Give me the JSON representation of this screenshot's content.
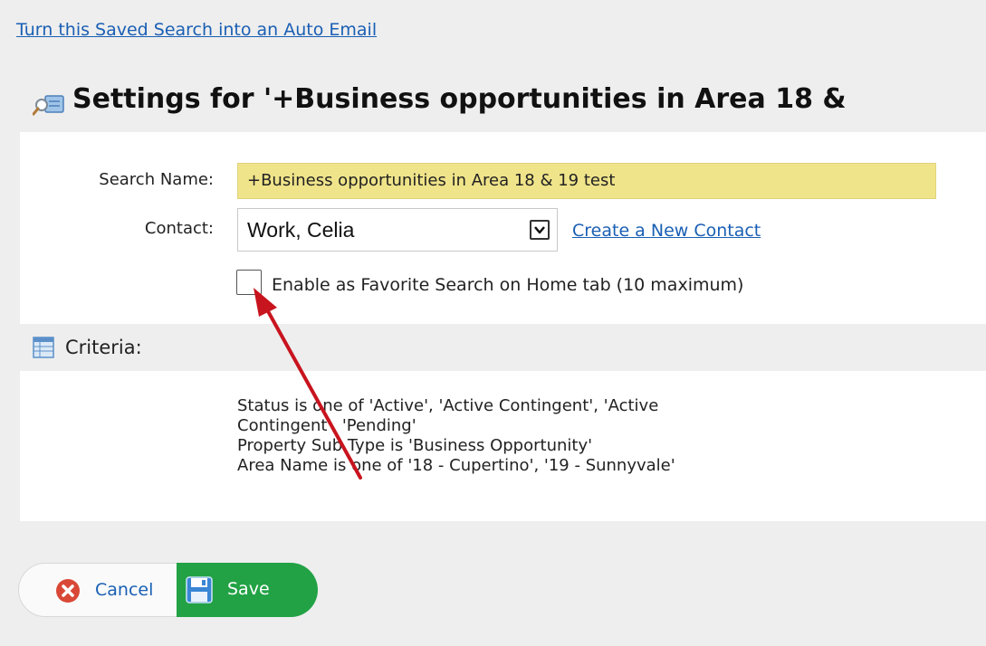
{
  "header": {
    "auto_email_link": "Turn this Saved Search into an Auto Email",
    "title": "Settings for '+Business opportunities in Area 18 &"
  },
  "form": {
    "search_name_label": "Search Name:",
    "search_name_value": "+Business opportunities in Area 18 & 19 test",
    "contact_label": "Contact:",
    "contact_value": "Work, Celia",
    "create_contact_link": "Create a New Contact",
    "favorite_checked": false,
    "favorite_label": "Enable as Favorite Search on Home tab (10 maximum)"
  },
  "criteria": {
    "label": "Criteria:",
    "lines": [
      "Status is one of 'Active', 'Active Contingent', 'Active",
      "Contingent', 'Pending'",
      "Property Sub Type is 'Business Opportunity'",
      "Area Name is one of '18 - Cupertino', '19 - Sunnyvale'"
    ]
  },
  "buttons": {
    "cancel_label": "Cancel",
    "save_label": "Save"
  },
  "icons": {
    "title": "saved-search-icon",
    "criteria": "table-icon",
    "cancel": "cancel-x-icon",
    "save": "floppy-disk-icon",
    "dropdown": "chevron-down-icon",
    "annotation": "red-arrow-icon"
  },
  "colors": {
    "link": "#1a5fb4",
    "input_highlight": "#f0e48a",
    "save_green": "#22a245",
    "cancel_red": "#d94836",
    "annotation_red": "#c8141e"
  }
}
